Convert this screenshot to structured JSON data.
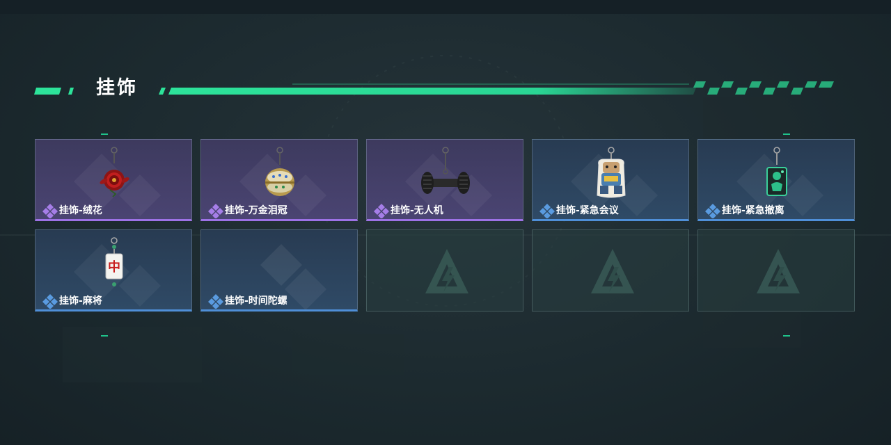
{
  "section": {
    "title": "挂饰"
  },
  "colors": {
    "accent_green": "#2de39a",
    "rarity_purple": "#9d72e6",
    "rarity_blue": "#4f8fd8"
  },
  "items": [
    {
      "label": "挂饰-绒花",
      "rarity": "purple",
      "icon": "red-rose-flower-charm"
    },
    {
      "label": "挂饰-万金泪冠",
      "rarity": "purple",
      "icon": "golden-jeweled-orb-charm"
    },
    {
      "label": "挂饰-无人机",
      "rarity": "purple",
      "icon": "drone-wheels-charm"
    },
    {
      "label": "挂饰-紧急会议",
      "rarity": "blue",
      "icon": "cartoon-figure-acrylic-charm"
    },
    {
      "label": "挂饰-紧急撤离",
      "rarity": "blue",
      "icon": "green-tag-charm"
    },
    {
      "label": "挂饰-麻将",
      "rarity": "blue",
      "icon": "mahjong-zhong-tile-charm"
    },
    {
      "label": "挂饰-时间陀螺",
      "rarity": "blue",
      "icon": "time-spinning-top-charm"
    }
  ],
  "empty_slots": [
    {
      "icon": "delta-logo-icon"
    },
    {
      "icon": "delta-logo-icon"
    },
    {
      "icon": "delta-logo-icon"
    }
  ],
  "mahjong_char": "中"
}
